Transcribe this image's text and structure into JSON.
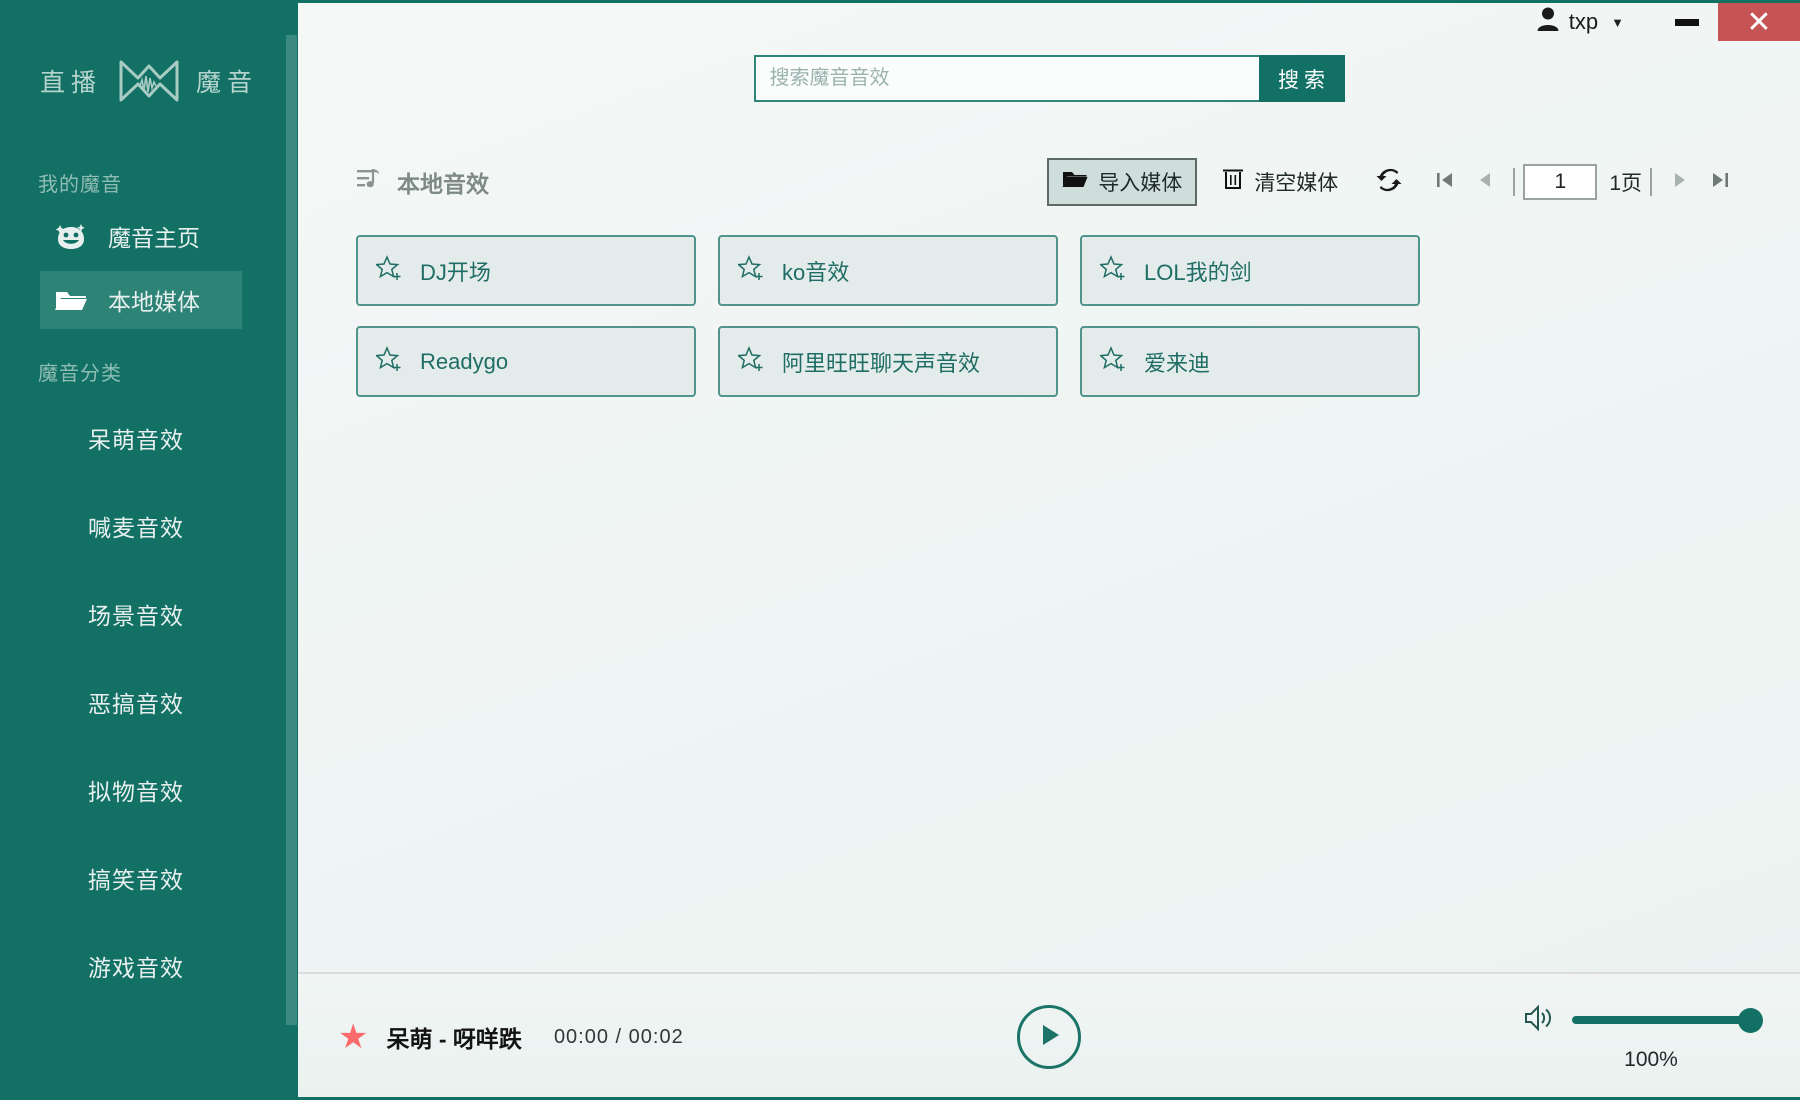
{
  "titlebar": {
    "user_name": "txp",
    "user_icon": "person-icon",
    "caret_icon": "chevron-down-icon",
    "minimize_label": "",
    "close_label": "✕"
  },
  "sidebar": {
    "brand": {
      "left_text": "直播",
      "right_text": "魔音",
      "logo_icon": "moyin-logo-icon"
    },
    "groups": [
      {
        "title": "我的魔音",
        "items": [
          {
            "label": "魔音主页",
            "icon": "clown-face-icon",
            "active": false
          },
          {
            "label": "本地媒体",
            "icon": "folder-icon",
            "active": true
          }
        ]
      },
      {
        "title": "魔音分类",
        "items": [
          {
            "label": "呆萌音效"
          },
          {
            "label": "喊麦音效"
          },
          {
            "label": "场景音效"
          },
          {
            "label": "恶搞音效"
          },
          {
            "label": "拟物音效"
          },
          {
            "label": "搞笑音效"
          },
          {
            "label": "游戏音效"
          }
        ]
      }
    ]
  },
  "search": {
    "placeholder": "搜索魔音音效",
    "value": "",
    "button_label": "搜索"
  },
  "toolbar": {
    "section_title": "本地音效",
    "section_icon": "playlist-music-icon",
    "import_label": "导入媒体",
    "import_icon": "folder-open-icon",
    "clear_label": "清空媒体",
    "clear_icon": "trash-icon"
  },
  "pager": {
    "refresh_icon": "refresh-icon",
    "first_icon": "first-page-icon",
    "prev_icon": "prev-page-icon",
    "next_icon": "next-page-icon",
    "last_icon": "last-page-icon",
    "current_page": "1",
    "total_label": "1页"
  },
  "cards": [
    {
      "label": "DJ开场",
      "icon": "star-plus-icon"
    },
    {
      "label": "ko音效",
      "icon": "star-plus-icon"
    },
    {
      "label": "LOL我的剑",
      "icon": "star-plus-icon"
    },
    {
      "label": "Readygo",
      "icon": "star-plus-icon"
    },
    {
      "label": "阿里旺旺聊天声音效",
      "icon": "star-plus-icon"
    },
    {
      "label": "爱来迪",
      "icon": "star-plus-icon"
    }
  ],
  "player": {
    "favorite_icon": "star-filled-icon",
    "track_title": "呆萌 - 呀咩跌",
    "time_text": "00:00 / 00:02",
    "play_icon": "play-icon",
    "volume_icon": "speaker-icon",
    "volume_percent": "100%"
  },
  "colors": {
    "brand_teal": "#127064",
    "sidebar_active": "#2d8376",
    "card_border": "#52948b",
    "card_text": "#1f6d64",
    "close_red": "#c65454",
    "favorite_red": "#fb6b6b"
  }
}
